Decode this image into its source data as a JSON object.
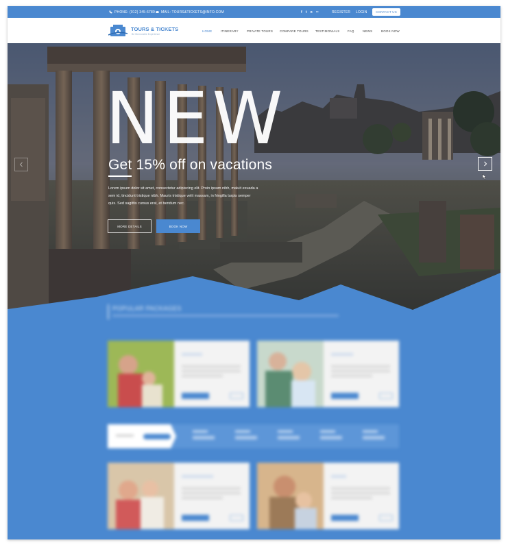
{
  "topbar": {
    "phone": "PHONE: (012) 345-6789",
    "mail": "MAIL: TOURS&TICKETS@INFO.COM",
    "social_icons": [
      "facebook-icon",
      "twitter-icon",
      "rss-icon",
      "flickr-icon"
    ],
    "social_glyphs": [
      "f",
      "t",
      "ʀ",
      "••"
    ],
    "register": "REGISTER",
    "login": "LOGIN",
    "contact": "CONTACT US"
  },
  "brand": {
    "name": "TOURS & TICKETS",
    "tagline": "Be Memorable Experience"
  },
  "nav": {
    "items": [
      "HOME",
      "ITINERARY",
      "PRIVATE TOURS",
      "COMPARE TOURS",
      "TESTIMONIALS",
      "FAQ",
      "NEWS",
      "BOOK NOW"
    ],
    "active_index": 0
  },
  "hero": {
    "title": "NEW",
    "subtitle": "Get 15% off on vacations",
    "text": "Lorem ipsum dolor sit amet, consectetur adipiscing elit. Proin ipsum nibh, maluit exuada a sem id, tincidunt tristique nibh. Mauris tristique velit massam, in fringilla turpis semper quis. Sed sagittis cursus erat, et bendum nec.",
    "more_label": "MORE DETAILS",
    "book_label": "BOOK NOW"
  },
  "colors": {
    "accent": "#4a88d0",
    "white": "#ffffff",
    "nav_text": "#444444"
  },
  "packages": {
    "title": "POPULAR PACKAGES"
  }
}
